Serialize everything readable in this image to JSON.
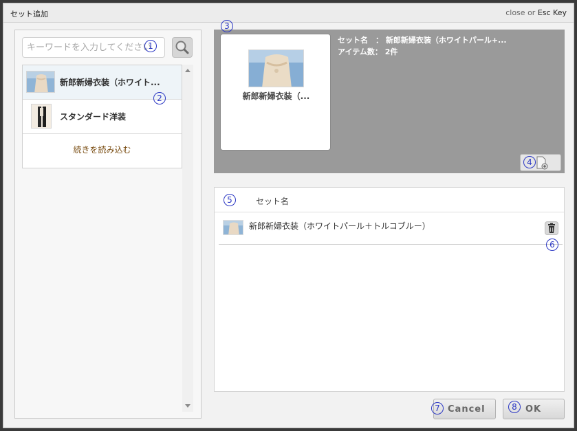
{
  "dialog": {
    "title": "セット追加",
    "close_text": "close",
    "close_or": "or",
    "close_key": "Esc Key"
  },
  "search": {
    "placeholder": "キーワードを入力してください",
    "value": ""
  },
  "results": {
    "items": [
      {
        "label": "新郎新婦衣装（ホワイト..."
      },
      {
        "label": "スタンダード洋装"
      }
    ],
    "load_more": "続きを読み込む"
  },
  "preview": {
    "card_name": "新郎新婦衣装（...",
    "set_name_label": "セット名　：",
    "set_name_value": "新郎新婦衣装（ホワイトパール+...",
    "item_count_label": "アイテム数：",
    "item_count_value": "2件"
  },
  "set_table": {
    "header": "セット名",
    "rows": [
      {
        "name": "新郎新婦衣装（ホワイトパール＋トルコブルー）"
      }
    ]
  },
  "buttons": {
    "cancel": "Cancel",
    "ok": "OK"
  },
  "markers": [
    "1",
    "2",
    "3",
    "4",
    "5",
    "6",
    "7",
    "8"
  ],
  "colors": {
    "marker": "#2c38c4",
    "preview_bg": "#9a9a9a",
    "load_more": "#7a4d12"
  }
}
